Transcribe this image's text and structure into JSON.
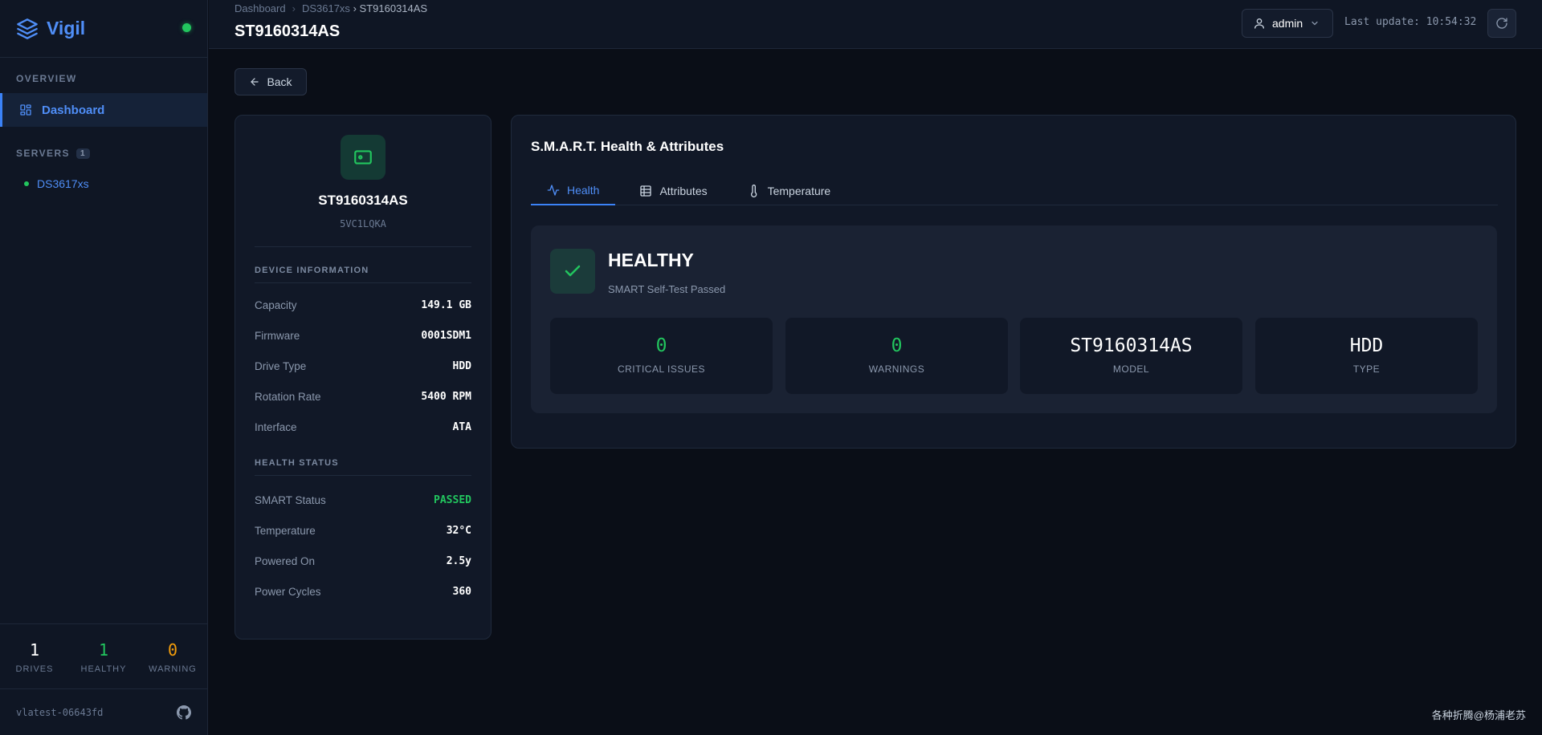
{
  "app": {
    "name": "Vigil",
    "version": "vlatest-06643fd"
  },
  "sidebar": {
    "overview_label": "OVERVIEW",
    "nav": [
      {
        "label": "Dashboard",
        "icon": "dashboard-grid-icon",
        "active": true
      }
    ],
    "servers_label": "SERVERS",
    "servers_count": "1",
    "servers": [
      {
        "name": "DS3617xs",
        "status": "online"
      }
    ],
    "stats": [
      {
        "value": "1",
        "label": "DRIVES",
        "color": "#ffffff"
      },
      {
        "value": "1",
        "label": "HEALTHY",
        "color": "#22c55e"
      },
      {
        "value": "0",
        "label": "WARNING",
        "color": "#f59e0b"
      }
    ]
  },
  "header": {
    "breadcrumb": [
      "Dashboard",
      "DS3617xs",
      "ST9160314AS"
    ],
    "breadcrumb_sep": "›",
    "title": "ST9160314AS",
    "user": "admin",
    "last_update": "Last update: 10:54:32"
  },
  "back_label": "Back",
  "device": {
    "name": "ST9160314AS",
    "serial": "5VC1LQKA",
    "device_info_label": "DEVICE INFORMATION",
    "device_info": [
      {
        "key": "Capacity",
        "value": "149.1 GB"
      },
      {
        "key": "Firmware",
        "value": "0001SDM1"
      },
      {
        "key": "Drive Type",
        "value": "HDD"
      },
      {
        "key": "Rotation Rate",
        "value": "5400 RPM"
      },
      {
        "key": "Interface",
        "value": "ATA"
      }
    ],
    "health_label": "HEALTH STATUS",
    "health": [
      {
        "key": "SMART Status",
        "value": "PASSED",
        "color": "#22c55e"
      },
      {
        "key": "Temperature",
        "value": "32°C",
        "color": "#ffffff"
      },
      {
        "key": "Powered On",
        "value": "2.5y",
        "color": "#ffffff"
      },
      {
        "key": "Power Cycles",
        "value": "360",
        "color": "#ffffff"
      }
    ]
  },
  "smart": {
    "title": "S.M.A.R.T. Health & Attributes",
    "tabs": [
      {
        "label": "Health",
        "icon": "activity-icon",
        "active": true
      },
      {
        "label": "Attributes",
        "icon": "table-icon",
        "active": false
      },
      {
        "label": "Temperature",
        "icon": "thermometer-icon",
        "active": false
      }
    ],
    "status": "HEALTHY",
    "status_sub": "SMART Self-Test Passed",
    "cards": [
      {
        "value": "0",
        "label": "CRITICAL ISSUES",
        "color": "#22c55e"
      },
      {
        "value": "0",
        "label": "WARNINGS",
        "color": "#22c55e"
      },
      {
        "value": "ST9160314AS",
        "label": "MODEL",
        "color": "#ffffff"
      },
      {
        "value": "HDD",
        "label": "TYPE",
        "color": "#ffffff"
      }
    ]
  },
  "watermark": "各种折腾@杨浦老苏",
  "colors": {
    "accent": "#3b82f6",
    "success": "#22c55e",
    "warning": "#f59e0b"
  }
}
